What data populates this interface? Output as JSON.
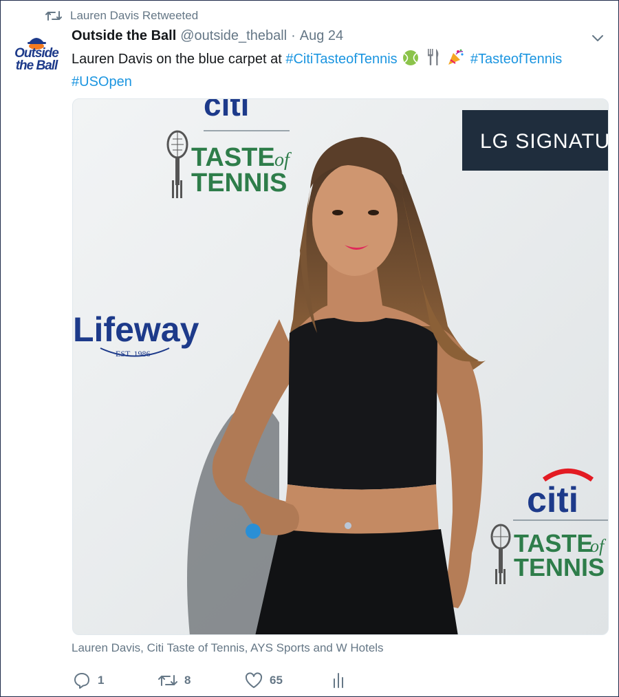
{
  "retweet": {
    "icon": "retweet-icon",
    "label": "Lauren Davis Retweeted"
  },
  "author": {
    "avatar_text_line1": "Outside",
    "avatar_text_line2": "the Ball",
    "name": "Outside the Ball",
    "handle": "@outside_theball",
    "separator": "·",
    "date": "Aug 24"
  },
  "tweet": {
    "text_before": "Lauren Davis on the blue carpet at",
    "hashtag1": "#CitiTasteofTennis",
    "emoji": [
      "tennis-ball-emoji",
      "fork-knife-emoji",
      "party-popper-emoji"
    ],
    "hashtag2": "#TasteofTennis",
    "hashtag3": "#USOpen"
  },
  "photo": {
    "backdrop": {
      "citi_top": "citi",
      "taste_line1": "TASTE",
      "taste_of": "of",
      "taste_line2": "TENNIS",
      "lg": "LG SIGNATU",
      "lifeway": "Lifeway",
      "lifeway_est": "EST. 1986",
      "citi_bottom": "citi",
      "taste2_line1": "TASTE",
      "taste2_of": "of",
      "taste2_line2": "TENNIS"
    }
  },
  "caption": "Lauren Davis, Citi Taste of Tennis, AYS Sports and W Hotels",
  "actions": {
    "reply_count": "1",
    "retweet_count": "8",
    "like_count": "65"
  },
  "colors": {
    "link": "#1b95e0",
    "muted": "#657786",
    "text": "#14171a",
    "citi_blue": "#1d3a8a",
    "taste_green": "#2e7d4a"
  }
}
